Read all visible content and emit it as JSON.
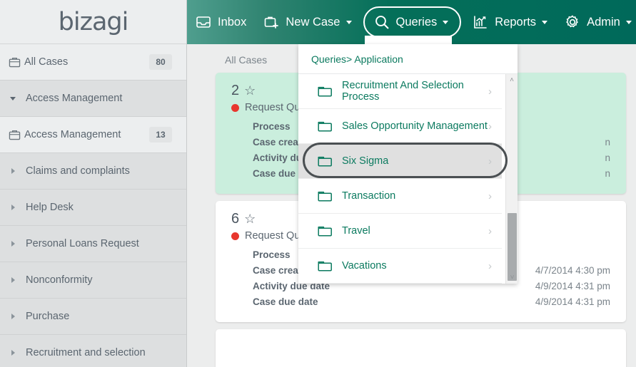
{
  "brand": {
    "logo": "bizagi"
  },
  "sidebar": {
    "items": [
      {
        "label": "All Cases",
        "badge": "80",
        "icon": "briefcase-icon",
        "twisty": "none",
        "shade": "light"
      },
      {
        "label": "Access Management",
        "badge": "",
        "icon": "none",
        "twisty": "down",
        "shade": "mid"
      },
      {
        "label": "Access Management",
        "badge": "13",
        "icon": "briefcase-icon",
        "twisty": "none",
        "shade": "light"
      },
      {
        "label": "Claims and complaints",
        "badge": "",
        "icon": "none",
        "twisty": "right",
        "shade": "mid"
      },
      {
        "label": "Help Desk",
        "badge": "",
        "icon": "none",
        "twisty": "right",
        "shade": "mid"
      },
      {
        "label": "Personal Loans Request",
        "badge": "",
        "icon": "none",
        "twisty": "right",
        "shade": "mid"
      },
      {
        "label": "Nonconformity",
        "badge": "",
        "icon": "none",
        "twisty": "right",
        "shade": "mid"
      },
      {
        "label": "Purchase",
        "badge": "",
        "icon": "none",
        "twisty": "right",
        "shade": "mid"
      },
      {
        "label": "Recruitment and selection",
        "badge": "",
        "icon": "none",
        "twisty": "right",
        "shade": "mid"
      }
    ]
  },
  "topbar": {
    "items": [
      {
        "label": "Inbox",
        "icon": "inbox-icon",
        "caret": false
      },
      {
        "label": "New Case",
        "icon": "new-case-icon",
        "caret": true
      },
      {
        "label": "Queries",
        "icon": "search-icon",
        "caret": true
      },
      {
        "label": "Reports",
        "icon": "reports-chart-icon",
        "caret": true
      },
      {
        "label": "Admin",
        "icon": "gear-icon",
        "caret": true
      }
    ]
  },
  "main": {
    "breadcrumb": "All Cases",
    "cards": [
      {
        "number": "2",
        "process_name": "Request Quot",
        "rows": [
          {
            "key": "Process",
            "value": ""
          },
          {
            "key": "Case creatio",
            "value": "n"
          },
          {
            "key": "Activity due",
            "value": "n"
          },
          {
            "key": "Case due da",
            "value": "n"
          }
        ]
      },
      {
        "number": "6",
        "process_name": "Request Quot",
        "rows": [
          {
            "key": "Process",
            "value": ""
          },
          {
            "key": "Case creation date",
            "value": "4/7/2014 4:30 pm"
          },
          {
            "key": "Activity due date",
            "value": "4/9/2014 4:31 pm"
          },
          {
            "key": "Case due date",
            "value": "4/9/2014 4:31 pm"
          }
        ]
      }
    ]
  },
  "dropdown": {
    "header": "Queries> Application",
    "items": [
      {
        "label": "Recruitment And Selection Process",
        "selected": false
      },
      {
        "label": "Sales Opportunity Management",
        "selected": false
      },
      {
        "label": "Six Sigma",
        "selected": true
      },
      {
        "label": "Transaction",
        "selected": false
      },
      {
        "label": "Travel",
        "selected": false
      },
      {
        "label": "Vacations",
        "selected": false
      }
    ],
    "scroll_up": "˄",
    "scroll_down": "˅",
    "chevron": "›"
  },
  "colors": {
    "brand_green_dark": "#00695a",
    "brand_green_light": "#4f9e8e",
    "link_green": "#0b7a5f",
    "card_green": "#caeedd",
    "status_red": "#e8372e",
    "sidebar_bg": "#dddfe0"
  }
}
